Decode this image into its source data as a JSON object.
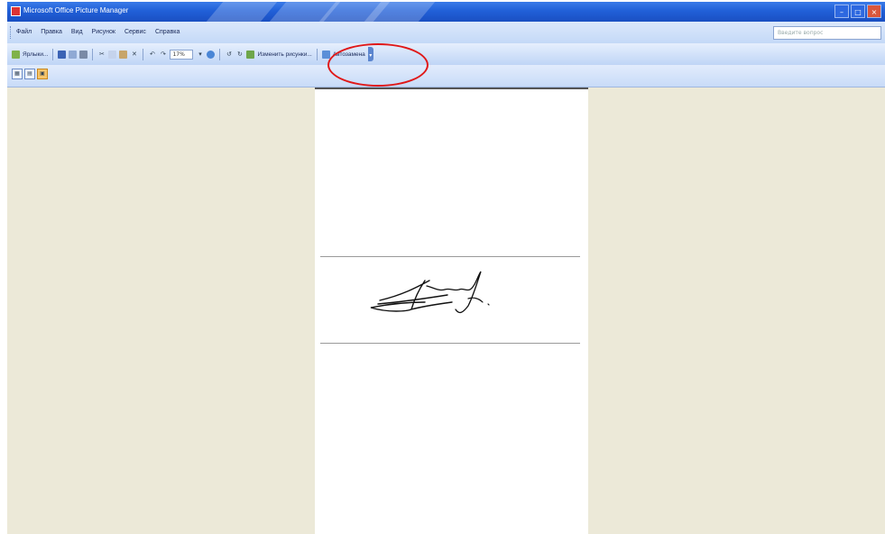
{
  "window": {
    "title": "Microsoft Office Picture Manager",
    "controls": {
      "minimize": "–",
      "maximize": "□",
      "close": "×"
    }
  },
  "menu": {
    "items": [
      "Файл",
      "Правка",
      "Вид",
      "Рисунок",
      "Сервис",
      "Справка"
    ],
    "help_placeholder": "Введите вопрос"
  },
  "toolbar": {
    "shortcuts_label": "Ярлыки...",
    "zoom_value": "17%",
    "edit_picture_label": "Изменить рисунки...",
    "autocorrect_label": "Автозамена",
    "icons": [
      "save-icon",
      "open-icon",
      "print-icon",
      "cut-icon",
      "copy-icon",
      "paste-icon",
      "delete-icon",
      "undo-icon",
      "redo-icon",
      "zoom-icon",
      "rotate-left-icon",
      "rotate-right-icon"
    ]
  },
  "view_modes": [
    "thumbnail-view-icon",
    "filmstrip-view-icon",
    "single-picture-view-icon"
  ],
  "colors": {
    "title_bar": "#2160d8",
    "annotation": "#e01818",
    "workspace": "#ece9d8"
  }
}
